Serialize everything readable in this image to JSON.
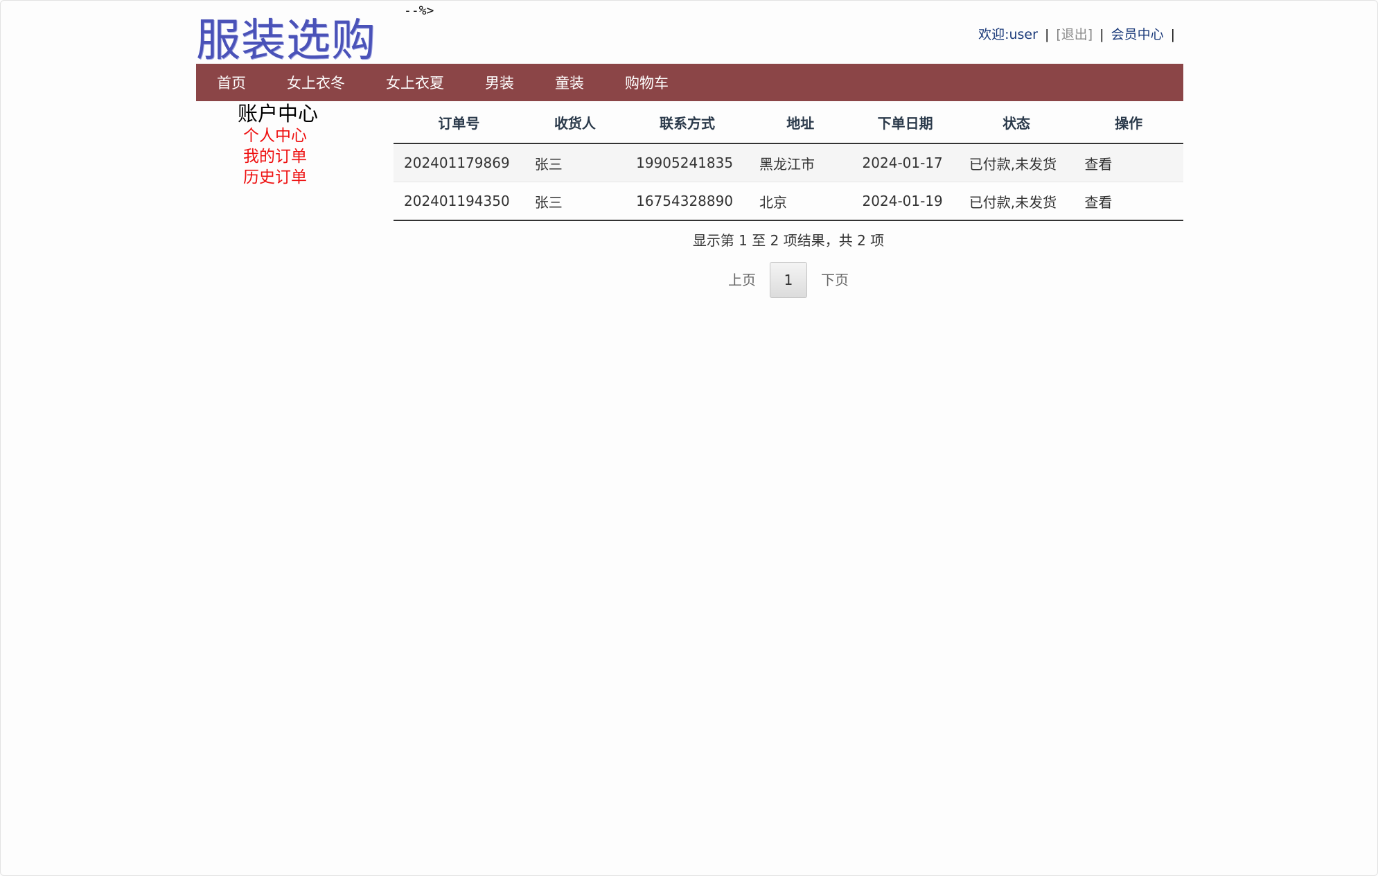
{
  "header": {
    "logo_text": "服装选购",
    "stray_text": "--%>",
    "welcome": "欢迎:user",
    "separator": "|",
    "logout": "[退出]",
    "member_center": "会员中心"
  },
  "nav": {
    "items": [
      {
        "label": "首页"
      },
      {
        "label": "女上衣冬"
      },
      {
        "label": "女上衣夏"
      },
      {
        "label": "男装"
      },
      {
        "label": "童装"
      },
      {
        "label": "购物车"
      }
    ]
  },
  "sidebar": {
    "title": "账户中心",
    "links": [
      {
        "label": "个人中心"
      },
      {
        "label": "我的订单"
      },
      {
        "label": "历史订单"
      }
    ]
  },
  "orders": {
    "columns": [
      "订单号",
      "收货人",
      "联系方式",
      "地址",
      "下单日期",
      "状态",
      "操作"
    ],
    "rows": [
      {
        "order_no": "202401179869",
        "receiver": "张三",
        "phone": "19905241835",
        "address": "黑龙江市",
        "date": "2024-01-17",
        "status": "已付款,未发货",
        "action": "查看"
      },
      {
        "order_no": "202401194350",
        "receiver": "张三",
        "phone": "16754328890",
        "address": "北京",
        "date": "2024-01-19",
        "status": "已付款,未发货",
        "action": "查看"
      }
    ]
  },
  "pagination": {
    "info": "显示第 1 至 2 项结果，共 2 项",
    "prev": "上页",
    "current": "1",
    "next": "下页"
  },
  "colors": {
    "nav_background": "#8b4547",
    "sidebar_link": "#ee1111",
    "logo": "#4a52b8"
  }
}
